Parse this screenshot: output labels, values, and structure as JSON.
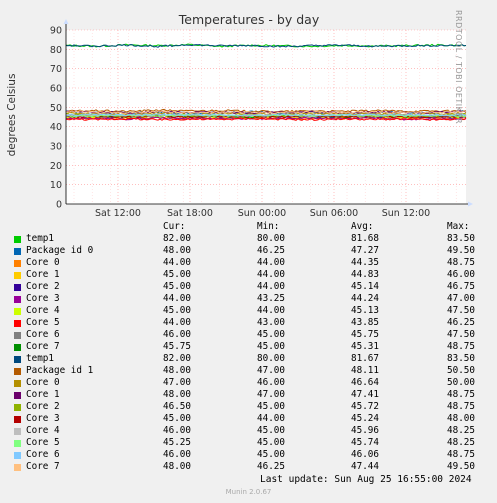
{
  "chart_data": {
    "type": "line",
    "title": "Temperatures - by day",
    "ylabel": "degrees Celsius",
    "xlabel": "",
    "ylim": [
      0,
      90
    ],
    "yticks": [
      0,
      10,
      20,
      30,
      40,
      50,
      60,
      70,
      80,
      90
    ],
    "xticks": [
      "Sat 12:00",
      "Sat 18:00",
      "Sun 00:00",
      "Sun 06:00",
      "Sun 12:00"
    ],
    "grid": true,
    "series": [
      {
        "name": "temp1",
        "color": "#00cc00",
        "values": [
          82.0,
          81.6,
          82.3,
          81.9,
          82.4,
          81.5,
          82.1,
          81.8,
          81.6,
          82.0,
          81.7,
          81.9,
          82.2,
          82.0
        ]
      },
      {
        "name": "Package id 0",
        "color": "#0066b3",
        "values": [
          48.0,
          47.5,
          47.1,
          47.6,
          46.9,
          47.3,
          47.8,
          47.0,
          47.4,
          46.8,
          47.2,
          47.5,
          47.1,
          48.0
        ]
      },
      {
        "name": "Core 0",
        "color": "#ff8000",
        "values": [
          44.0,
          44.5,
          44.2,
          44.8,
          44.1,
          44.4,
          44.6,
          44.0,
          44.3,
          44.2,
          44.7,
          44.1,
          44.5,
          44.0
        ]
      },
      {
        "name": "Core 1",
        "color": "#ffcc00",
        "values": [
          45.0,
          44.6,
          45.3,
          44.8,
          45.5,
          44.7,
          45.1,
          44.9,
          44.6,
          45.2,
          44.8,
          44.9,
          45.1,
          45.0
        ]
      },
      {
        "name": "Core 2",
        "color": "#330099",
        "values": [
          45.0,
          45.3,
          44.9,
          45.6,
          45.2,
          45.0,
          45.4,
          45.1,
          44.9,
          45.3,
          45.0,
          45.2,
          44.8,
          45.0
        ]
      },
      {
        "name": "Core 3",
        "color": "#990099",
        "values": [
          44.0,
          44.3,
          43.9,
          44.5,
          44.1,
          44.4,
          44.0,
          44.2,
          44.6,
          44.1,
          44.3,
          43.8,
          44.2,
          44.0
        ]
      },
      {
        "name": "Core 4",
        "color": "#ccff00",
        "values": [
          45.0,
          45.4,
          44.9,
          45.6,
          45.1,
          45.3,
          44.8,
          45.2,
          45.5,
          45.0,
          45.3,
          44.9,
          45.1,
          45.0
        ]
      },
      {
        "name": "Core 5",
        "color": "#ff0000",
        "values": [
          44.0,
          43.6,
          44.1,
          43.5,
          43.9,
          43.7,
          44.2,
          43.8,
          43.6,
          44.0,
          43.7,
          43.9,
          43.5,
          44.0
        ]
      },
      {
        "name": "Core 6",
        "color": "#808080",
        "values": [
          46.0,
          45.8,
          45.5,
          46.1,
          45.7,
          45.4,
          45.9,
          45.6,
          45.8,
          45.3,
          46.0,
          45.7,
          45.5,
          46.0
        ]
      },
      {
        "name": "Core 7",
        "color": "#008f00",
        "values": [
          45.75,
          45.4,
          45.1,
          45.6,
          45.2,
          45.5,
          45.0,
          45.4,
          45.3,
          45.1,
          45.6,
          45.2,
          45.4,
          45.75
        ]
      },
      {
        "name": "temp1",
        "color": "#00487d",
        "values": [
          82.0,
          81.7,
          82.2,
          81.5,
          82.4,
          81.8,
          82.0,
          81.4,
          81.9,
          82.1,
          81.6,
          81.8,
          82.0,
          82.0
        ]
      },
      {
        "name": "Package id 1",
        "color": "#b35a00",
        "values": [
          48.0,
          48.3,
          47.9,
          48.6,
          48.1,
          48.4,
          48.0,
          47.8,
          48.2,
          47.9,
          48.3,
          48.0,
          48.1,
          48.0
        ]
      },
      {
        "name": "Core 0",
        "color": "#b38f00",
        "values": [
          47.0,
          46.8,
          46.5,
          47.1,
          46.4,
          46.9,
          46.6,
          46.3,
          46.8,
          46.5,
          46.7,
          46.4,
          46.6,
          47.0
        ]
      },
      {
        "name": "Core 1",
        "color": "#6b006b",
        "values": [
          48.0,
          47.6,
          47.2,
          47.8,
          47.3,
          47.5,
          47.1,
          47.4,
          47.6,
          47.2,
          47.5,
          47.3,
          47.4,
          48.0
        ]
      },
      {
        "name": "Core 2",
        "color": "#8fb300",
        "values": [
          46.5,
          45.9,
          45.6,
          46.0,
          45.5,
          45.8,
          45.7,
          45.4,
          45.9,
          45.6,
          45.8,
          45.5,
          45.7,
          46.5
        ]
      },
      {
        "name": "Core 3",
        "color": "#b30000",
        "values": [
          45.0,
          45.3,
          45.1,
          45.5,
          44.9,
          45.4,
          45.2,
          45.0,
          45.3,
          45.1,
          45.4,
          44.9,
          45.2,
          45.0
        ]
      },
      {
        "name": "Core 4",
        "color": "#bebebe",
        "values": [
          46.0,
          45.8,
          46.1,
          45.7,
          46.2,
          45.9,
          45.8,
          46.0,
          45.7,
          46.1,
          45.9,
          45.8,
          46.0,
          46.0
        ]
      },
      {
        "name": "Core 5",
        "color": "#80ff80",
        "values": [
          45.25,
          45.6,
          45.9,
          45.5,
          46.0,
          45.7,
          45.6,
          45.8,
          45.5,
          45.9,
          45.7,
          45.6,
          45.8,
          45.25
        ]
      },
      {
        "name": "Core 6",
        "color": "#80c9ff",
        "values": [
          46.0,
          46.2,
          45.9,
          46.3,
          46.0,
          46.1,
          45.8,
          46.2,
          46.0,
          45.9,
          46.3,
          46.1,
          46.0,
          46.0
        ]
      },
      {
        "name": "Core 7",
        "color": "#ffc080",
        "values": [
          48.0,
          47.6,
          47.3,
          47.8,
          47.2,
          47.5,
          47.4,
          47.1,
          47.6,
          47.3,
          47.5,
          47.2,
          47.4,
          48.0
        ]
      }
    ]
  },
  "side_credit": "RRDTOOL / TOBI OETIKER",
  "legend": {
    "headers": {
      "cur": "Cur:",
      "min": "Min:",
      "avg": "Avg:",
      "max": "Max:"
    },
    "rows": [
      {
        "name": "temp1",
        "cur": "82.00",
        "min": "80.00",
        "avg": "81.68",
        "max": "83.50"
      },
      {
        "name": "Package id 0",
        "cur": "48.00",
        "min": "46.25",
        "avg": "47.27",
        "max": "49.50"
      },
      {
        "name": "Core 0",
        "cur": "44.00",
        "min": "44.00",
        "avg": "44.35",
        "max": "48.75"
      },
      {
        "name": "Core 1",
        "cur": "45.00",
        "min": "44.00",
        "avg": "44.83",
        "max": "46.00"
      },
      {
        "name": "Core 2",
        "cur": "45.00",
        "min": "44.00",
        "avg": "45.14",
        "max": "46.75"
      },
      {
        "name": "Core 3",
        "cur": "44.00",
        "min": "43.25",
        "avg": "44.24",
        "max": "47.00"
      },
      {
        "name": "Core 4",
        "cur": "45.00",
        "min": "44.00",
        "avg": "45.13",
        "max": "47.50"
      },
      {
        "name": "Core 5",
        "cur": "44.00",
        "min": "43.00",
        "avg": "43.85",
        "max": "46.25"
      },
      {
        "name": "Core 6",
        "cur": "46.00",
        "min": "45.00",
        "avg": "45.75",
        "max": "47.50"
      },
      {
        "name": "Core 7",
        "cur": "45.75",
        "min": "45.00",
        "avg": "45.31",
        "max": "48.75"
      },
      {
        "name": "temp1",
        "cur": "82.00",
        "min": "80.00",
        "avg": "81.67",
        "max": "83.50"
      },
      {
        "name": "Package id 1",
        "cur": "48.00",
        "min": "47.00",
        "avg": "48.11",
        "max": "50.50"
      },
      {
        "name": "Core 0",
        "cur": "47.00",
        "min": "46.00",
        "avg": "46.64",
        "max": "50.00"
      },
      {
        "name": "Core 1",
        "cur": "48.00",
        "min": "47.00",
        "avg": "47.41",
        "max": "48.75"
      },
      {
        "name": "Core 2",
        "cur": "46.50",
        "min": "45.00",
        "avg": "45.72",
        "max": "48.75"
      },
      {
        "name": "Core 3",
        "cur": "45.00",
        "min": "44.00",
        "avg": "45.24",
        "max": "48.00"
      },
      {
        "name": "Core 4",
        "cur": "46.00",
        "min": "45.00",
        "avg": "45.96",
        "max": "48.25"
      },
      {
        "name": "Core 5",
        "cur": "45.25",
        "min": "45.00",
        "avg": "45.74",
        "max": "48.25"
      },
      {
        "name": "Core 6",
        "cur": "46.00",
        "min": "45.00",
        "avg": "46.06",
        "max": "48.75"
      },
      {
        "name": "Core 7",
        "cur": "48.00",
        "min": "46.25",
        "avg": "47.44",
        "max": "49.50"
      }
    ]
  },
  "footer": {
    "last_update": "Last update: Sun Aug 25 16:55:00 2024",
    "munin": "Munin 2.0.67"
  }
}
